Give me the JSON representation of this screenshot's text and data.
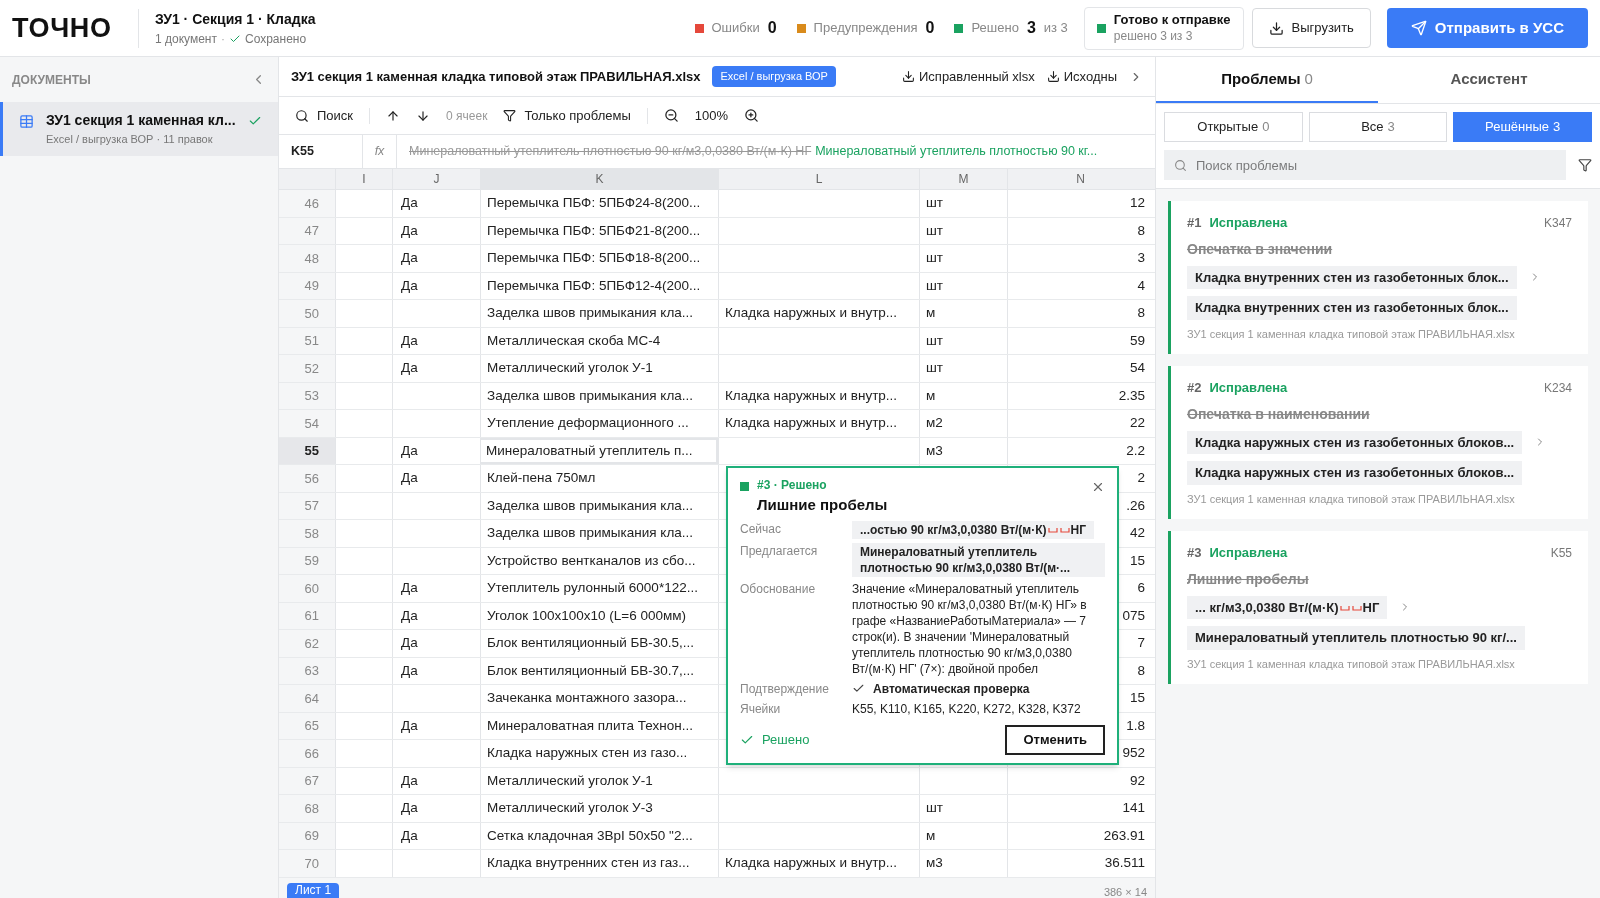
{
  "header": {
    "logo": "ТОЧНО",
    "title": "ЗУ1 · Секция 1 · Кладка",
    "doc_count": "1 документ",
    "separator": "·",
    "save_state": "Сохранено",
    "stats": [
      {
        "label": "Ошибки",
        "value": "0",
        "color": "#e5483b"
      },
      {
        "label": "Предупреждения",
        "value": "0",
        "color": "#d98b1c"
      },
      {
        "label": "Решено",
        "value": "3",
        "suffix": "из 3",
        "color": "#1aa260"
      }
    ],
    "ready": {
      "title": "Готово к отправке",
      "subtitle": "решено 3 из 3"
    },
    "export_button": "Выгрузить",
    "send_button": "Отправить в УСС"
  },
  "sidebar": {
    "title": "ДОКУМЕНТЫ",
    "items": [
      {
        "name": "ЗУ1 секция 1 каменная кл...",
        "meta": "Excel / выгрузка ВОР · 11 правок",
        "selected": true
      }
    ]
  },
  "file_bar": {
    "filename": "ЗУ1 секция 1 каменная кладка типовой этаж ПРАВИЛЬНАЯ.xlsx",
    "badge": "Excel / выгрузка ВОР",
    "actions": [
      "Исправленный xlsx",
      "Исходны"
    ]
  },
  "toolbar": {
    "search": "Поиск",
    "match_count": "0 ячеек",
    "filter": "Только проблемы",
    "zoom": "100%"
  },
  "formula_bar": {
    "cell": "K55",
    "fx": "fx",
    "old_value": "Минераловатный утеплитель плотностью 90 кг/м3,0,0380 Вт/(м·К) НГ",
    "new_value": "Минераловатный утеплитель плотностью 90 кг..."
  },
  "table": {
    "columns": [
      {
        "label": "I",
        "selected": false
      },
      {
        "label": "J",
        "selected": false
      },
      {
        "label": "K",
        "selected": true
      },
      {
        "label": "L",
        "selected": false
      },
      {
        "label": "M",
        "selected": false
      },
      {
        "label": "N",
        "selected": false
      }
    ],
    "rows": [
      {
        "n": "46",
        "j": "Да",
        "k": "Перемычка ПБФ: 5ПБФ24-8(200...",
        "m": "шт",
        "v": "12",
        "selected": false
      },
      {
        "n": "47",
        "j": "Да",
        "k": "Перемычка ПБФ: 5ПБФ21-8(200...",
        "m": "шт",
        "v": "8",
        "selected": false
      },
      {
        "n": "48",
        "j": "Да",
        "k": "Перемычка ПБФ: 5ПБФ18-8(200...",
        "m": "шт",
        "v": "3",
        "selected": false
      },
      {
        "n": "49",
        "j": "Да",
        "k": "Перемычка ПБФ: 5ПБФ12-4(200...",
        "m": "шт",
        "v": "4",
        "selected": false
      },
      {
        "n": "50",
        "k": "Заделка швов примыкания кла...",
        "l": "Кладка наружных и внутр...",
        "m": "м",
        "v": "8",
        "selected": false
      },
      {
        "n": "51",
        "j": "Да",
        "k": "Металлическая скоба МС-4",
        "m": "шт",
        "v": "59",
        "selected": false
      },
      {
        "n": "52",
        "j": "Да",
        "k": "Металлический уголок У-1",
        "m": "шт",
        "v": "54",
        "selected": false
      },
      {
        "n": "53",
        "k": "Заделка швов примыкания кла...",
        "l": "Кладка наружных и внутр...",
        "m": "м",
        "v": "2.35",
        "selected": false
      },
      {
        "n": "54",
        "k": "Утепление деформационного ...",
        "l": "Кладка наружных и внутр...",
        "m": "м2",
        "v": "22",
        "selected": false
      },
      {
        "n": "55",
        "j": "Да",
        "k": "Минераловатный утеплитель п...",
        "m": "м3",
        "v": "2.2",
        "selected": true
      },
      {
        "n": "56",
        "j": "Да",
        "k": "Клей-пена 750мл",
        "v": "2",
        "selected": false
      },
      {
        "n": "57",
        "k": "Заделка швов примыкания кла...",
        "v": ".26",
        "selected": false
      },
      {
        "n": "58",
        "k": "Заделка швов примыкания кла...",
        "v": "42",
        "selected": false
      },
      {
        "n": "59",
        "k": "Устройство вентканалов из сбо...",
        "v": "15",
        "selected": false
      },
      {
        "n": "60",
        "j": "Да",
        "k": "Утеплитель рулонный 6000*122...",
        "v": "6",
        "selected": false
      },
      {
        "n": "61",
        "j": "Да",
        "k": "Уголок 100x100x10 (L=6 000мм)",
        "v": "075",
        "selected": false
      },
      {
        "n": "62",
        "j": "Да",
        "k": "Блок вентиляционный БВ-30.5,...",
        "v": "7",
        "selected": false
      },
      {
        "n": "63",
        "j": "Да",
        "k": "Блок вентиляционный БВ-30.7,...",
        "v": "8",
        "selected": false
      },
      {
        "n": "64",
        "k": "Зачеканка монтажного зазора...",
        "v": "15",
        "selected": false
      },
      {
        "n": "65",
        "j": "Да",
        "k": "Минераловатная плита Технон...",
        "v": "1.8",
        "selected": false
      },
      {
        "n": "66",
        "k": "Кладка наружных стен из газо...",
        "v": "952",
        "selected": false
      },
      {
        "n": "67",
        "j": "Да",
        "k": "Металлический уголок У-1",
        "v": "92",
        "selected": false
      },
      {
        "n": "68",
        "j": "Да",
        "k": "Металлический уголок У-3",
        "m": "шт",
        "v": "141",
        "selected": false
      },
      {
        "n": "69",
        "j": "Да",
        "k": "Сетка кладочная 3ВрI 50x50 \"2...",
        "m": "м",
        "v": "263.91",
        "selected": false
      },
      {
        "n": "70",
        "k": "Кладка внутренних стен из газ...",
        "l": "Кладка наружных и внутр...",
        "m": "м3",
        "v": "36.511",
        "selected": false
      }
    ]
  },
  "sheet_bar": {
    "sheets": [
      {
        "label": "Лист 1",
        "selected": true
      }
    ],
    "size": "386 × 14"
  },
  "popup": {
    "status": "#3 · Решено",
    "title": "Лишние пробелы",
    "fields": [
      {
        "label": "Сейчас",
        "kind": "chip",
        "parts": [
          "...остью 90 кг/м3,0,0380 Вт/(м·К)",
          "НГ"
        ]
      },
      {
        "label": "Предлагается",
        "kind": "chip",
        "parts": [
          "Минераловатный утеплитель плотностью 90 кг/м3,0,0380 Вт/(м·..."
        ]
      },
      {
        "label": "Обоснование",
        "kind": "text",
        "text": "Значение «Минераловатный утеплитель плотностью 90 кг/м3,0,0380 Вт/(м·К) НГ» в графе «НазваниеРаботыМатериала» — 7 строк(и). В значении 'Минераловатный утеплитель плотностью 90 кг/м3,0,0380 Вт/(м·К) НГ' (7×): двойной пробел"
      },
      {
        "label": "Подтверждение",
        "kind": "check",
        "text": "Автоматическая проверка"
      },
      {
        "label": "Ячейки",
        "kind": "text",
        "text": "K55, K110, K165, K220, K272, K328, K372"
      }
    ],
    "resolved": "Решено",
    "undo_button": "Отменить"
  },
  "right_panel": {
    "tabs": [
      {
        "label": "Проблемы",
        "count": "0",
        "selected": true
      },
      {
        "label": "Ассистент",
        "selected": false
      }
    ],
    "filters": [
      {
        "label": "Открытые",
        "count": "0",
        "selected": false
      },
      {
        "label": "Все",
        "count": "3",
        "selected": false
      },
      {
        "label": "Решённые",
        "count": "3",
        "selected": true
      }
    ],
    "search_placeholder": "Поиск проблемы",
    "issues": [
      {
        "number": "#1",
        "status": "Исправлена",
        "cell": "K347",
        "title": "Опечатка в значении",
        "from": [
          "Кладка внутренних стен из газобетонных блок..."
        ],
        "to": [
          "Кладка внутренних стен из газобетонных блок..."
        ],
        "file": "ЗУ1 секция 1 каменная кладка типовой этаж ПРАВИЛЬНАЯ.xlsx"
      },
      {
        "number": "#2",
        "status": "Исправлена",
        "cell": "K234",
        "title": "Опечатка в наименовании",
        "from": [
          "Кладка наружных стен из газобетонных блоков..."
        ],
        "to": [
          "Кладка наружных стен из газобетонных блоков..."
        ],
        "file": "ЗУ1 секция 1 каменная кладка типовой этаж ПРАВИЛЬНАЯ.xlsx"
      },
      {
        "number": "#3",
        "status": "Исправлена",
        "cell": "K55",
        "title": "Лишние пробелы",
        "from": [
          "... кг/м3,0,0380 Вт/(м·К)",
          "НГ"
        ],
        "to": [
          "Минераловатный утеплитель плотностью 90 кг/..."
        ],
        "file": "ЗУ1 секция 1 каменная кладка типовой этаж ПРАВИЛЬНАЯ.xlsx"
      }
    ]
  }
}
